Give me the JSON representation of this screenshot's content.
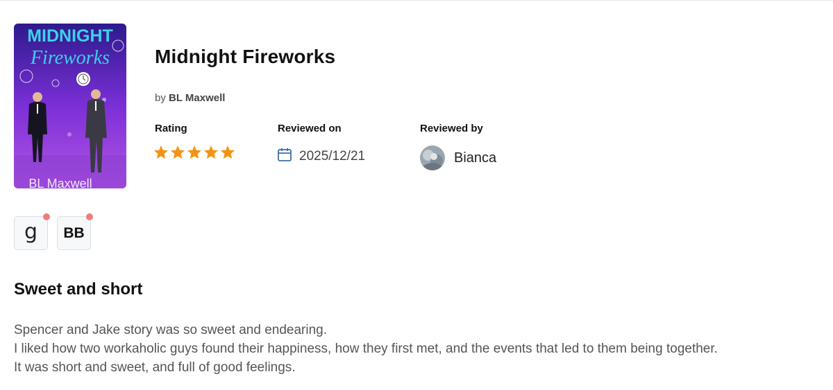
{
  "book": {
    "title": "Midnight Fireworks",
    "by_prefix": "by",
    "author": "BL Maxwell",
    "cover": {
      "title_line1": "MIDNIGHT",
      "title_line2": "Fireworks",
      "author_text": "BL Maxwell",
      "colors": {
        "top": "#2d1a8c",
        "mid": "#7b2fd6",
        "bottom": "#b455e6",
        "title": "#3fd0ea"
      }
    }
  },
  "meta": {
    "rating_label": "Rating",
    "rating_value": 5,
    "rating_max": 5,
    "star_color": "#f39314",
    "reviewed_on_label": "Reviewed on",
    "reviewed_on_date": "2025/12/21",
    "reviewed_by_label": "Reviewed by",
    "reviewer_name": "Bianca",
    "calendar_icon": "calendar-icon",
    "calendar_icon_color": "#3a6ea8"
  },
  "badges": [
    {
      "text": "g",
      "name": "goodreads-badge"
    },
    {
      "text": "BB",
      "name": "bookbub-badge"
    }
  ],
  "badge_dot_color": "#f07c7c",
  "review": {
    "heading": "Sweet and short",
    "lines": [
      "Spencer and Jake story was so sweet and endearing.",
      "I liked how two workaholic guys found their happiness, how they first met, and the events that led to them being together.",
      "It was short and sweet, and full of good feelings."
    ]
  }
}
